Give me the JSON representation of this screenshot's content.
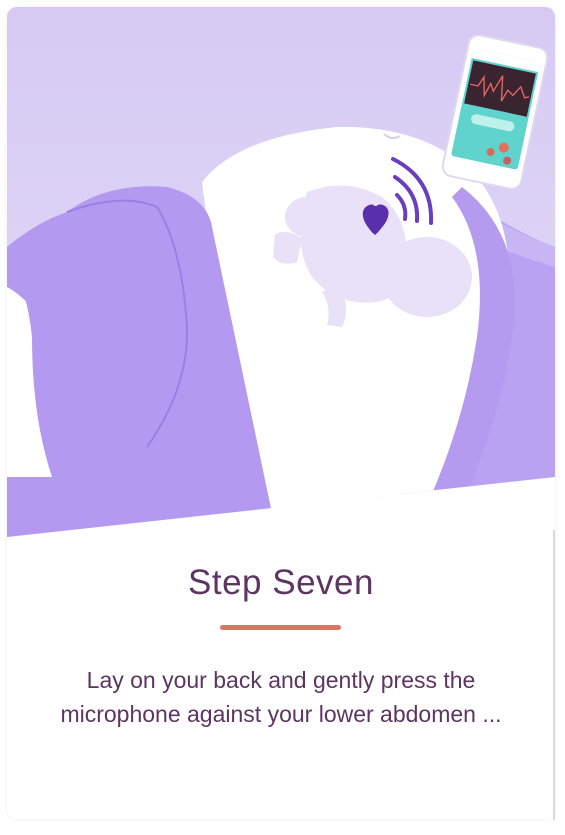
{
  "step": {
    "title": "Step Seven",
    "description": "Lay on your back and gently press the microphone against your lower abdomen ..."
  },
  "colors": {
    "background_lavender": "#d9cef4",
    "clothing_purple": "#b39af0",
    "heart_purple": "#5a2fae",
    "title_text": "#5c3560",
    "divider_accent": "#dd7565",
    "phone_screen_teal": "#5fd3cc"
  },
  "illustration": {
    "icons": [
      "phone-icon",
      "heart-icon",
      "sound-waves-icon",
      "fetus-icon"
    ]
  }
}
